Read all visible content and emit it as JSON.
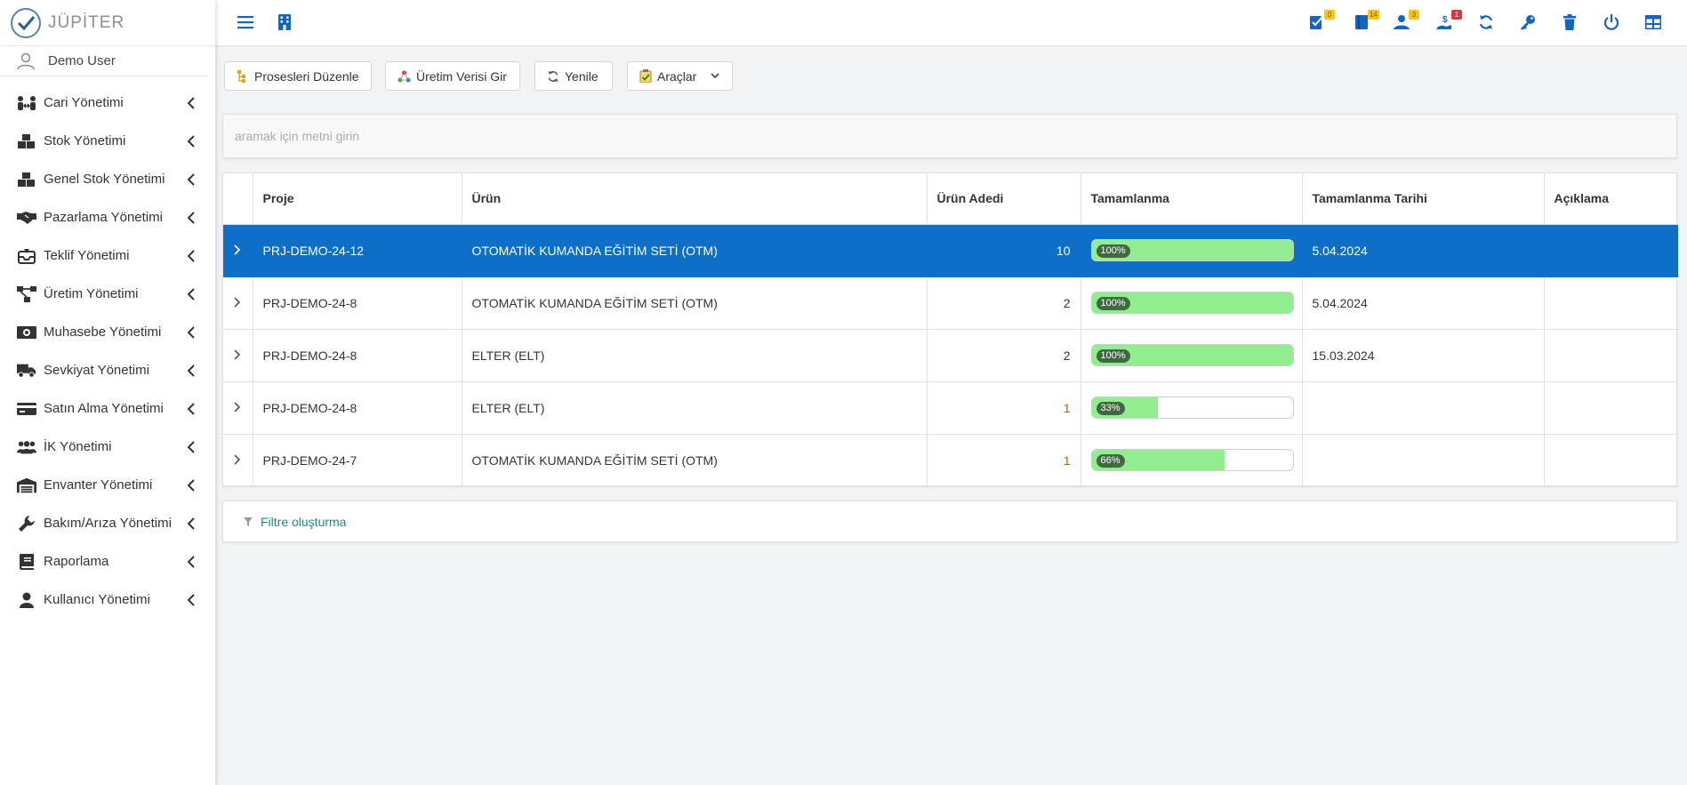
{
  "app": {
    "logo_text": "JÜPİTER"
  },
  "user": {
    "name": "Demo User"
  },
  "sidebar": {
    "items": [
      {
        "label": "Cari Yönetimi",
        "icon": "people-arrows-icon"
      },
      {
        "label": "Stok Yönetimi",
        "icon": "boxes-icon"
      },
      {
        "label": "Genel Stok Yönetimi",
        "icon": "boxes-icon"
      },
      {
        "label": "Pazarlama Yönetimi",
        "icon": "handshake-icon"
      },
      {
        "label": "Teklif Yönetimi",
        "icon": "inbox-icon"
      },
      {
        "label": "Üretim Yönetimi",
        "icon": "project-diagram-icon"
      },
      {
        "label": "Muhasebe Yönetimi",
        "icon": "money-icon"
      },
      {
        "label": "Sevkiyat Yönetimi",
        "icon": "truck-icon"
      },
      {
        "label": "Satın Alma Yönetimi",
        "icon": "credit-card-icon"
      },
      {
        "label": "İK Yönetimi",
        "icon": "users-icon"
      },
      {
        "label": "Envanter Yönetimi",
        "icon": "warehouse-icon"
      },
      {
        "label": "Bakım/Arıza Yönetimi",
        "icon": "wrench-icon"
      },
      {
        "label": "Raporlama",
        "icon": "book-icon"
      },
      {
        "label": "Kullanıcı Yönetimi",
        "icon": "user-icon"
      }
    ]
  },
  "topbar": {
    "badges": {
      "tasks": "0",
      "notes": "14",
      "approvals": "3",
      "payments": "1"
    }
  },
  "toolbar": {
    "edit_processes": "Prosesleri Düzenle",
    "enter_production": "Üretim Verisi Gir",
    "refresh": "Yenile",
    "tools": "Araçlar"
  },
  "search": {
    "placeholder": "aramak için metni girin"
  },
  "grid": {
    "columns": [
      "Proje",
      "Ürün",
      "Ürün Adedi",
      "Tamamlanma",
      "Tamamlanma Tarihi",
      "Açıklama"
    ],
    "rows": [
      {
        "project": "PRJ-DEMO-24-12",
        "product": "OTOMATİK KUMANDA EĞİTİM SETİ (OTM)",
        "qty": "10",
        "completion": 1.0,
        "completion_label": "100%",
        "date": "5.04.2024",
        "note": "",
        "selected": true
      },
      {
        "project": "PRJ-DEMO-24-8",
        "product": "OTOMATİK KUMANDA EĞİTİM SETİ (OTM)",
        "qty": "2",
        "completion": 1.0,
        "completion_label": "100%",
        "date": "5.04.2024",
        "note": ""
      },
      {
        "project": "PRJ-DEMO-24-8",
        "product": "ELTER (ELT)",
        "qty": "2",
        "completion": 1.0,
        "completion_label": "100%",
        "date": "15.03.2024",
        "note": ""
      },
      {
        "project": "PRJ-DEMO-24-8",
        "product": "ELTER (ELT)",
        "qty": "1",
        "completion": 0.33,
        "completion_label": "33%",
        "date": "",
        "note": ""
      },
      {
        "project": "PRJ-DEMO-24-7",
        "product": "OTOMATİK KUMANDA EĞİTİM SETİ (OTM)",
        "qty": "1",
        "completion": 0.66,
        "completion_label": "66%",
        "date": "",
        "note": ""
      }
    ]
  },
  "filter": {
    "label": "Filtre oluşturma"
  },
  "colors": {
    "accent": "#0d6fc7",
    "progress": "#90ee90",
    "link": "#1a8a8a",
    "icon_blue": "#1565c0"
  }
}
